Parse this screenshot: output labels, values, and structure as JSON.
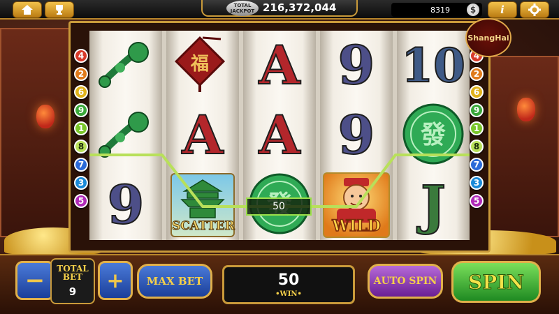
{
  "topbar": {
    "home_icon": "home-icon",
    "trophy_icon": "trophy-icon",
    "jackpot_logo_line1": "TOTAL",
    "jackpot_logo_line2": "JACKPOT",
    "jackpot_value": "216,372,044",
    "credits": "8319",
    "coin_symbol": "$",
    "info_label": "i",
    "settings_icon": "gear-icon"
  },
  "logo": {
    "text": "ShangHai"
  },
  "reels": [
    {
      "symbols": [
        "ruyi",
        "ruyi",
        "9"
      ]
    },
    {
      "symbols": [
        "pouch",
        "A",
        "scatter"
      ]
    },
    {
      "symbols": [
        "A",
        "A",
        "coin"
      ]
    },
    {
      "symbols": [
        "9",
        "9",
        "wild"
      ]
    },
    {
      "symbols": [
        "10",
        "coin",
        "J"
      ]
    }
  ],
  "symbol_labels": {
    "scatter": "SCATTER",
    "wild": "WILD",
    "pouch_char": "福",
    "coin_char": "發"
  },
  "paylines": {
    "left": [
      "4",
      "2",
      "6",
      "9",
      "1",
      "8",
      "7",
      "3",
      "5"
    ],
    "right": [
      "4",
      "2",
      "6",
      "9",
      "1",
      "8",
      "7",
      "3",
      "5"
    ],
    "colors": [
      "#d83a2a",
      "#e07a1a",
      "#e0b21a",
      "#3aa83a",
      "#7ac62a",
      "#d6c21a",
      "#2a6ad8",
      "#1a8ad8",
      "#b02ab8"
    ],
    "active_line": "8",
    "active_color": "#b8e05a"
  },
  "win_line_amount": "50",
  "controls": {
    "bet_minus": "−",
    "bet_plus": "+",
    "total_bet_label": "TOTAL BET",
    "total_bet_value": "9",
    "max_bet_label": "MAX BET",
    "win_value": "50",
    "win_caption": "•WIN•",
    "auto_spin_label": "AUTO SPIN",
    "spin_label": "SPIN"
  }
}
